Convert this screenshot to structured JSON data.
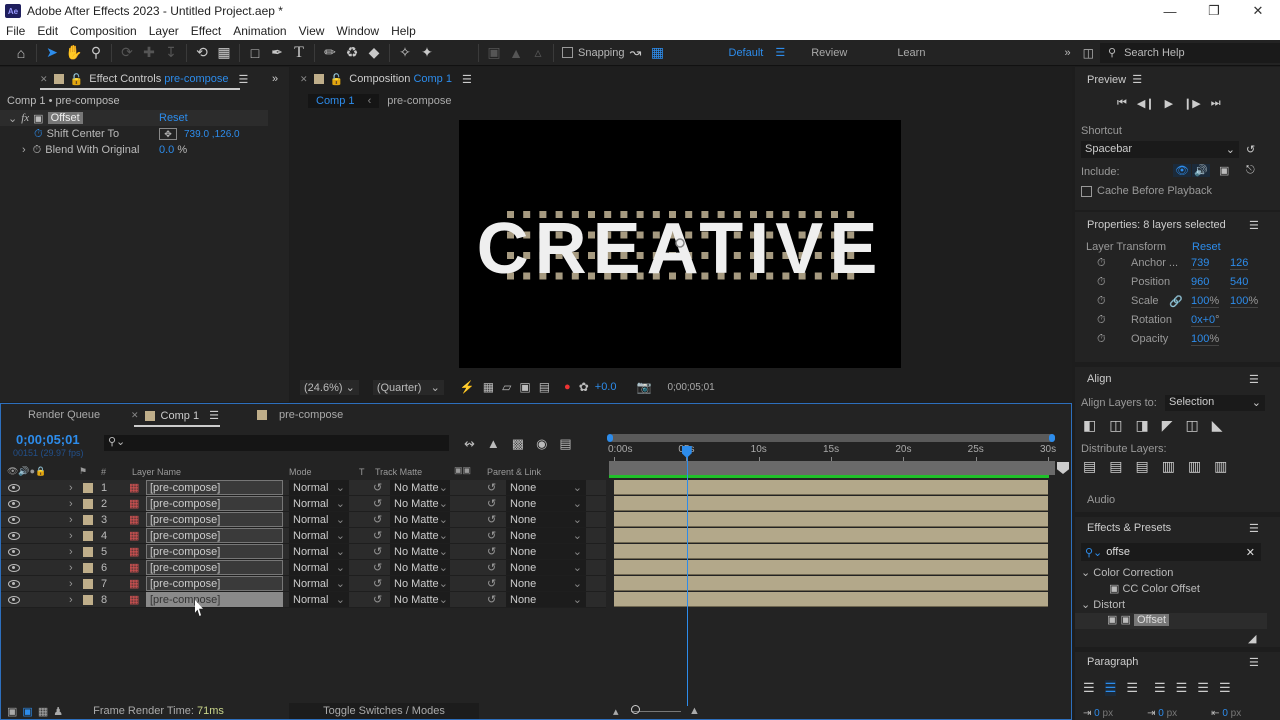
{
  "window": {
    "title": "Adobe After Effects 2023 - Untitled Project.aep *",
    "app_icon": "Ae"
  },
  "menu": [
    "File",
    "Edit",
    "Composition",
    "Layer",
    "Effect",
    "Animation",
    "View",
    "Window",
    "Help"
  ],
  "toolbar": {
    "tools": [
      "home-icon",
      "selection-tool-icon",
      "hand-tool-icon",
      "zoom-tool-icon",
      "orbit-camera-icon",
      "pan-camera-icon",
      "dolly-camera-icon",
      "rotation-tool-icon",
      "pan-behind-icon",
      "rectangle-tool-icon",
      "pen-tool-icon",
      "type-tool-icon",
      "brush-tool-icon",
      "clone-stamp-icon",
      "eraser-icon",
      "roto-brush-icon",
      "puppet-pin-icon"
    ],
    "snapping_label": "Snapping",
    "workspaces": [
      "Default",
      "Review",
      "Learn"
    ],
    "active_workspace": "Default",
    "search_help": "Search Help"
  },
  "effect_controls": {
    "tab_label": "Effect Controls",
    "tab_target": "pre-compose",
    "breadcrumb": "Comp 1 • pre-compose",
    "effect_name": "Offset",
    "reset_label": "Reset",
    "props": [
      {
        "name": "Shift Center To",
        "value": "739.0 ,126.0"
      },
      {
        "name": "Blend With Original",
        "value": "0.0",
        "unit": "%"
      }
    ]
  },
  "composition": {
    "tab_label": "Composition",
    "tab_target": "Comp 1",
    "crumbs": [
      "Comp 1",
      "pre-compose"
    ],
    "viewer_text": "CREATIVE",
    "zoom": "(24.6%)",
    "resolution": "(Quarter)",
    "exposure": "+0.0",
    "timecode": "0;00;05;01"
  },
  "preview": {
    "title": "Preview",
    "shortcut_label": "Shortcut",
    "shortcut": "Spacebar",
    "include_label": "Include:",
    "cache_label": "Cache Before Playback"
  },
  "properties": {
    "title": "Properties: 8 layers selected",
    "section": "Layer Transform",
    "reset": "Reset",
    "items": [
      {
        "name": "Anchor ...",
        "v1": "739",
        "v2": "126"
      },
      {
        "name": "Position",
        "v1": "960",
        "v2": "540"
      },
      {
        "name": "Scale",
        "v1": "100",
        "v2": "100",
        "unit": "%"
      },
      {
        "name": "Rotation",
        "v1": "0x+0",
        "unit": "°"
      },
      {
        "name": "Opacity",
        "v1": "100",
        "unit": "%"
      }
    ]
  },
  "align": {
    "title": "Align",
    "align_to_label": "Align Layers to:",
    "align_to": "Selection",
    "distribute_label": "Distribute Layers:",
    "audio_label": "Audio"
  },
  "effects_presets": {
    "title": "Effects & Presets",
    "search": "offse",
    "groups": [
      {
        "name": "Color Correction",
        "items": [
          "CC Color Offset"
        ]
      },
      {
        "name": "Distort",
        "items": [
          "Offset"
        ]
      }
    ]
  },
  "paragraph": {
    "title": "Paragraph",
    "indent_values": [
      "0",
      "0",
      "0"
    ],
    "indent_unit": "px"
  },
  "timeline": {
    "tabs": [
      "Render Queue",
      "Comp 1",
      "pre-compose"
    ],
    "active_tab": "Comp 1",
    "timecode": "0;00;05;01",
    "frame_info": "00151 (29.97 fps)",
    "columns": [
      "#",
      "Layer Name",
      "Mode",
      "T",
      "Track Matte",
      "Parent & Link"
    ],
    "layers": [
      {
        "num": "1",
        "name": "[pre-compose]",
        "mode": "Normal",
        "matte": "No Matte",
        "parent": "None"
      },
      {
        "num": "2",
        "name": "[pre-compose]",
        "mode": "Normal",
        "matte": "No Matte",
        "parent": "None"
      },
      {
        "num": "3",
        "name": "[pre-compose]",
        "mode": "Normal",
        "matte": "No Matte",
        "parent": "None"
      },
      {
        "num": "4",
        "name": "[pre-compose]",
        "mode": "Normal",
        "matte": "No Matte",
        "parent": "None"
      },
      {
        "num": "5",
        "name": "[pre-compose]",
        "mode": "Normal",
        "matte": "No Matte",
        "parent": "None"
      },
      {
        "num": "6",
        "name": "[pre-compose]",
        "mode": "Normal",
        "matte": "No Matte",
        "parent": "None"
      },
      {
        "num": "7",
        "name": "[pre-compose]",
        "mode": "Normal",
        "matte": "No Matte",
        "parent": "None"
      },
      {
        "num": "8",
        "name": "[pre-compose]",
        "mode": "Normal",
        "matte": "No Matte",
        "parent": "None"
      }
    ],
    "ruler": [
      "0:00s",
      "05s",
      "10s",
      "15s",
      "20s",
      "25s",
      "30s"
    ],
    "playhead_seconds": 5.03,
    "duration_seconds": 30,
    "render_time_label": "Frame Render Time:",
    "render_time": "71ms",
    "toggle_label": "Toggle Switches / Modes"
  }
}
